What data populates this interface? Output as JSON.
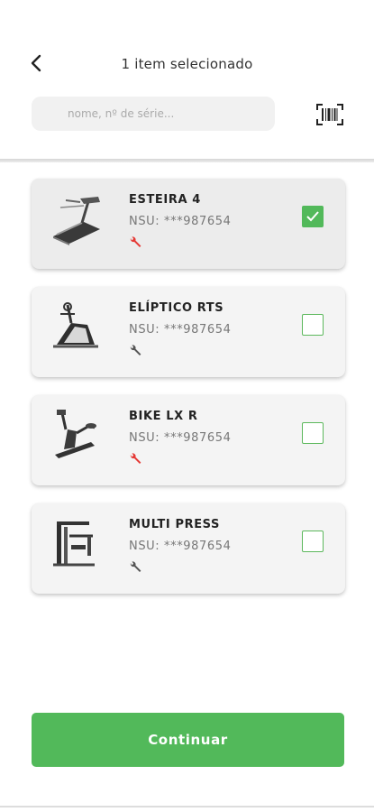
{
  "header": {
    "title": "1 item selecionado",
    "back_icon": "chevron-left-icon",
    "scan_icon": "barcode-scan-icon"
  },
  "search": {
    "placeholder": "nome, nº de série...",
    "value": ""
  },
  "colors": {
    "accent": "#52b95a",
    "wrench_alert": "#e53935",
    "wrench_ok": "#555555"
  },
  "items": [
    {
      "name": "ESTEIRA 4",
      "nsu": "NSU: ***987654",
      "icon": "treadmill-icon",
      "maintenance_alert": true,
      "selected": true
    },
    {
      "name": "ELÍPTICO RTS",
      "nsu": "NSU: ***987654",
      "icon": "elliptical-icon",
      "maintenance_alert": false,
      "selected": false
    },
    {
      "name": "BIKE LX R",
      "nsu": "NSU: ***987654",
      "icon": "exercise-bike-icon",
      "maintenance_alert": true,
      "selected": false
    },
    {
      "name": "MULTI PRESS",
      "nsu": "NSU: ***987654",
      "icon": "multi-press-icon",
      "maintenance_alert": false,
      "selected": false
    }
  ],
  "footer": {
    "continue_label": "Continuar"
  }
}
